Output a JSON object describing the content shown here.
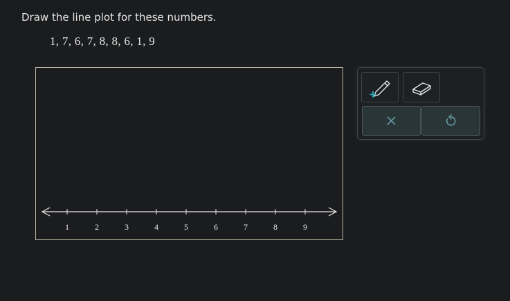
{
  "question": {
    "instruction": "Draw the line plot for these numbers.",
    "numbers": "1, 7, 6, 7, 8, 8, 6, 1, 9"
  },
  "number_line": {
    "tick_labels": [
      "1",
      "2",
      "3",
      "4",
      "5",
      "6",
      "7",
      "8",
      "9"
    ],
    "range": [
      0.5,
      9.5
    ],
    "plotted_points": []
  },
  "toolbox": {
    "pen_tool": "pencil-icon",
    "eraser_tool": "eraser-icon",
    "clear_button": "close-icon",
    "undo_button": "undo-icon"
  },
  "colors": {
    "background": "#1b1c1e",
    "accent": "#2aa3b5",
    "border": "#bdb8a4"
  }
}
